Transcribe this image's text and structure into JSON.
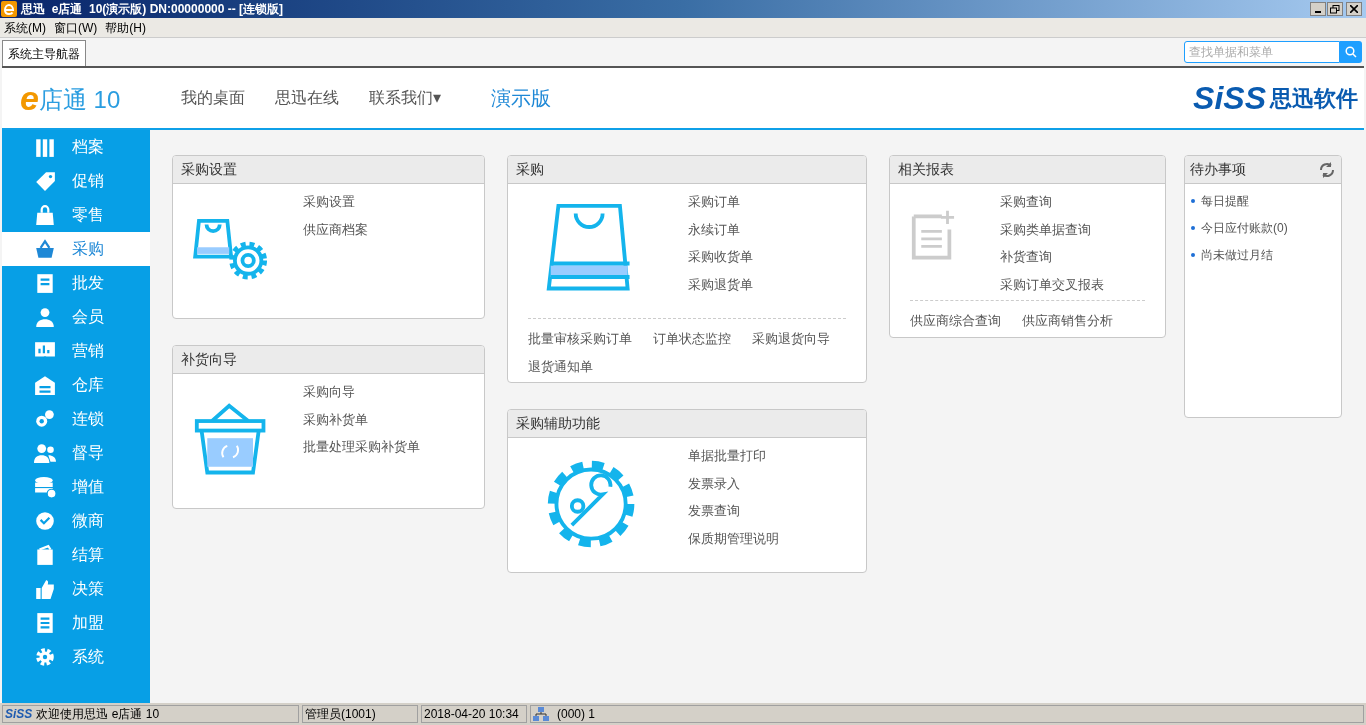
{
  "window": {
    "title": "思迅  e店通  10(演示版) DN:00000000 -- [连锁版]"
  },
  "menu": [
    "系统(M)",
    "窗口(W)",
    "帮助(H)"
  ],
  "tabs": [
    {
      "label": "系统主导航器",
      "selected": true
    }
  ],
  "search": {
    "placeholder": "查找单据和菜单"
  },
  "header": {
    "logo": "店通 10",
    "logo_letter": "e",
    "nav": [
      "我的桌面",
      "思迅在线",
      "联系我们▾"
    ],
    "edition": "演示版",
    "brand": "SiSS",
    "brand_suffix": "思迅软件"
  },
  "sidebar": {
    "items": [
      {
        "label": "档案",
        "selected": false
      },
      {
        "label": "促销",
        "selected": false
      },
      {
        "label": "零售",
        "selected": false
      },
      {
        "label": "采购",
        "selected": true
      },
      {
        "label": "批发",
        "selected": false
      },
      {
        "label": "会员",
        "selected": false
      },
      {
        "label": "营销",
        "selected": false
      },
      {
        "label": "仓库",
        "selected": false
      },
      {
        "label": "连锁",
        "selected": false
      },
      {
        "label": "督导",
        "selected": false
      },
      {
        "label": "增值",
        "selected": false
      },
      {
        "label": "微商",
        "selected": false
      },
      {
        "label": "结算",
        "selected": false
      },
      {
        "label": "决策",
        "selected": false
      },
      {
        "label": "加盟",
        "selected": false
      },
      {
        "label": "系统",
        "selected": false
      }
    ]
  },
  "cards": [
    {
      "title": "采购设置",
      "links": [
        "采购设置",
        "供应商档案"
      ]
    },
    {
      "title": "补货向导",
      "links": [
        "采购向导",
        "采购补货单",
        "批量处理采购补货单"
      ]
    },
    {
      "title": "采购",
      "links": [
        "采购订单",
        "永续订单",
        "采购收货单",
        "采购退货单"
      ],
      "footer_links": [
        "批量审核采购订单",
        "订单状态监控",
        "采购退货向导",
        "退货通知单"
      ]
    },
    {
      "title": "采购辅助功能",
      "links": [
        "单据批量打印",
        "发票录入",
        "发票查询",
        "保质期管理说明"
      ]
    },
    {
      "title": "相关报表",
      "links": [
        "采购查询",
        "采购类单据查询",
        "补货查询",
        "采购订单交叉报表"
      ],
      "footer_links": [
        "供应商综合查询",
        "供应商销售分析"
      ]
    }
  ],
  "todo": {
    "title": "待办事项",
    "items": [
      "每日提醒",
      "今日应付账款(0)",
      "尚未做过月结"
    ]
  },
  "status_bar": {
    "brand": "SiSS",
    "welcome": "欢迎使用思迅 e店通 10",
    "user": "管理员(1001)",
    "datetime": "2018-04-20 10:34",
    "network": "(000) 1"
  }
}
